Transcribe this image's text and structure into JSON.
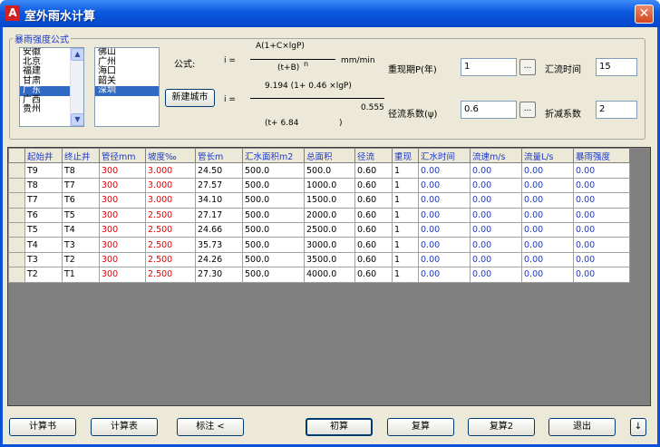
{
  "window": {
    "title": "室外雨水计算",
    "app_icon": "A",
    "close_glyph": "✕"
  },
  "group_label": "暴雨强度公式",
  "provinces": [
    "安徽",
    "北京",
    "福建",
    "甘肃",
    "广东",
    "广西",
    "贵州"
  ],
  "provinces_selected_index": 4,
  "cities": [
    "佛山",
    "广州",
    "海口",
    "韶关",
    "深圳"
  ],
  "cities_selected_index": 4,
  "new_city_button": "新建城市",
  "formula": {
    "label": "公式:",
    "i1": "i =",
    "num": "A(1+C×lgP)",
    "unit": "mm/min",
    "den": "(t+B)",
    "den_exp": "n",
    "i2": "i =",
    "num2": "9.194   (1+  0.46  ×lgP)",
    "den2a": "(t+ 6.84",
    "den2b": ")",
    "den2_exp": "0.555"
  },
  "params": {
    "period_label": "重现期P(年)",
    "period_value": "1",
    "runoff_label": "径流系数(ψ)",
    "runoff_value": "0.6",
    "conc_label": "汇流时间",
    "conc_value": "15",
    "reduce_label": "折减系数",
    "reduce_value": "2",
    "browse_glyph": "..."
  },
  "table": {
    "headers": [
      "起始井",
      "终止井",
      "管径mm",
      "坡度‰",
      "管长m",
      "汇水面积m2",
      "总面积",
      "径流",
      "重现",
      "汇水时间",
      "流速m/s",
      "流量L/s",
      "暴雨强度"
    ],
    "rows": [
      [
        "T9",
        "T8",
        "300",
        "3.000",
        "24.50",
        "500.0",
        "500.0",
        "0.60",
        "1",
        "0.00",
        "0.00",
        "0.00",
        "0.00"
      ],
      [
        "T8",
        "T7",
        "300",
        "3.000",
        "27.57",
        "500.0",
        "1000.0",
        "0.60",
        "1",
        "0.00",
        "0.00",
        "0.00",
        "0.00"
      ],
      [
        "T7",
        "T6",
        "300",
        "3.000",
        "34.10",
        "500.0",
        "1500.0",
        "0.60",
        "1",
        "0.00",
        "0.00",
        "0.00",
        "0.00"
      ],
      [
        "T6",
        "T5",
        "300",
        "2.500",
        "27.17",
        "500.0",
        "2000.0",
        "0.60",
        "1",
        "0.00",
        "0.00",
        "0.00",
        "0.00"
      ],
      [
        "T5",
        "T4",
        "300",
        "2.500",
        "24.66",
        "500.0",
        "2500.0",
        "0.60",
        "1",
        "0.00",
        "0.00",
        "0.00",
        "0.00"
      ],
      [
        "T4",
        "T3",
        "300",
        "2.500",
        "35.73",
        "500.0",
        "3000.0",
        "0.60",
        "1",
        "0.00",
        "0.00",
        "0.00",
        "0.00"
      ],
      [
        "T3",
        "T2",
        "300",
        "2.500",
        "24.26",
        "500.0",
        "3500.0",
        "0.60",
        "1",
        "0.00",
        "0.00",
        "0.00",
        "0.00"
      ],
      [
        "T2",
        "T1",
        "300",
        "2.500",
        "27.30",
        "500.0",
        "4000.0",
        "0.60",
        "1",
        "0.00",
        "0.00",
        "0.00",
        "0.00"
      ]
    ]
  },
  "buttons": {
    "calc_book": "计算书",
    "calc_table": "计算表",
    "annotate": "标注 <",
    "initial": "初算",
    "recalc": "复算",
    "recalc2": "复算2",
    "exit": "退出",
    "extra": "↓"
  }
}
